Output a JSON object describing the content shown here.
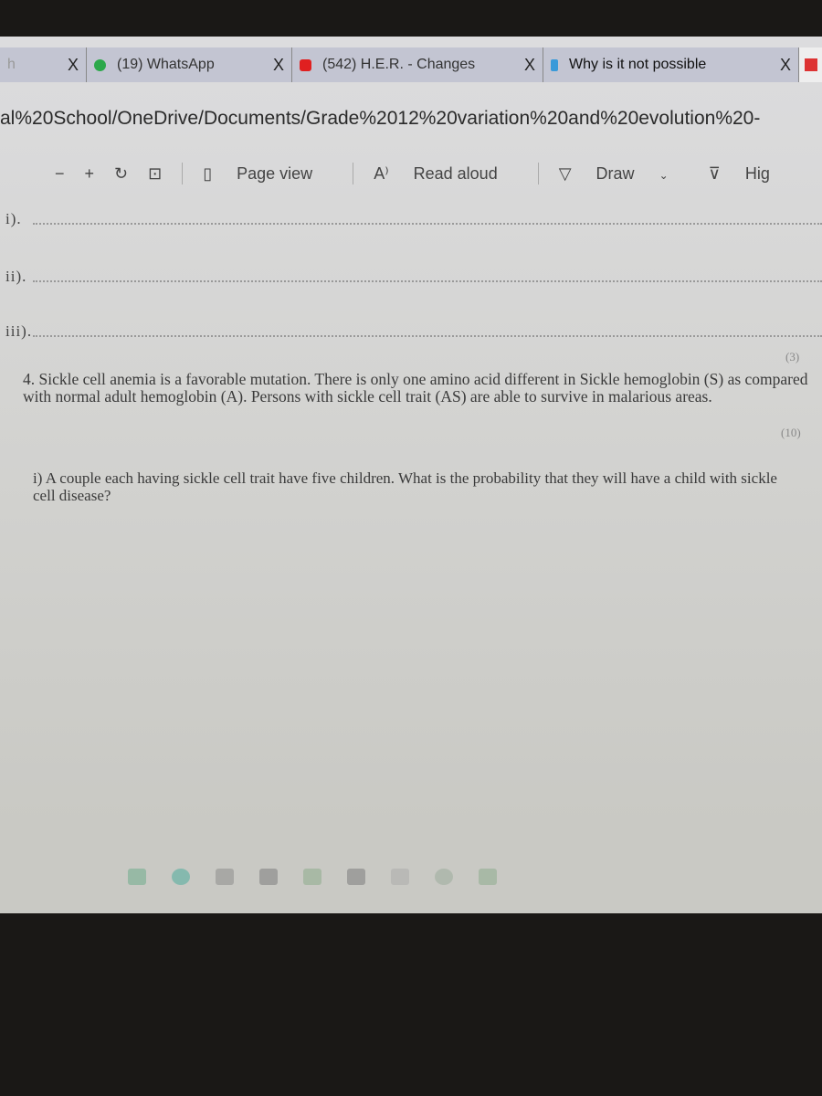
{
  "browser": {
    "tabs": [
      {
        "label": "h",
        "close": "X"
      },
      {
        "label": "(19) WhatsApp",
        "close": "X",
        "icon": "whatsapp-icon",
        "color": "#2ca84a"
      },
      {
        "label": "(542) H.E.R. - Changes",
        "close": "X",
        "icon": "youtube-icon",
        "color": "#e02020"
      },
      {
        "label": "Why is it not possible",
        "close": "X",
        "icon": "bing-icon",
        "color": "#3a9ad9"
      }
    ],
    "address": "al%20School/OneDrive/Documents/Grade%2012%20variation%20and%20evolution%20-"
  },
  "toolbar": {
    "zoom_out": "−",
    "zoom_in": "+",
    "page_view": "Page view",
    "read_aloud": "Read aloud",
    "draw": "Draw",
    "highlight": "Hig"
  },
  "document": {
    "answer_lines": [
      "i).",
      "ii).",
      "iii)."
    ],
    "mark_3": "(3)",
    "question": "4. Sickle cell anemia is a favorable mutation.  There is only one amino acid different in Sickle hemoglobin (S) as compared with normal adult hemoglobin (A).  Persons with sickle cell trait (AS) are able to survive in malarious areas.",
    "mark_10": "(10)",
    "sub_question": "i)  A couple each having sickle cell trait have five children.  What is the probability that they will have a child with sickle cell disease?"
  }
}
